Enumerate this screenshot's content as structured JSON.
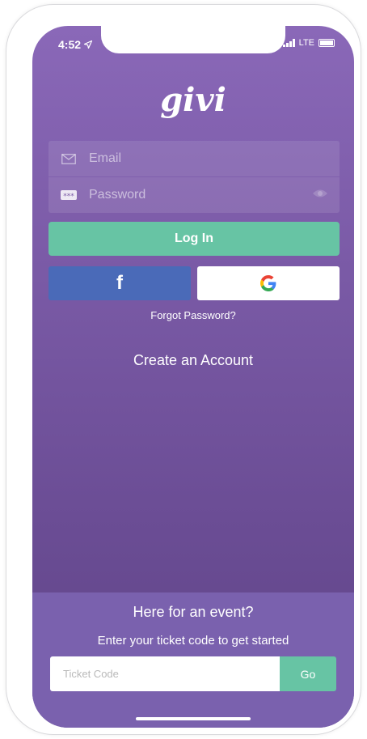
{
  "status_bar": {
    "time": "4:52",
    "network": "LTE"
  },
  "app": {
    "logo_text": "givi"
  },
  "login_form": {
    "email_placeholder": "Email",
    "password_placeholder": "Password",
    "login_label": "Log In",
    "facebook_label": "f",
    "forgot_label": "Forgot Password?",
    "create_account_label": "Create an Account"
  },
  "event_section": {
    "title": "Here for an event?",
    "subtitle": "Enter your ticket code to get started",
    "ticket_placeholder": "Ticket Code",
    "go_label": "Go"
  },
  "icons": {
    "email": "envelope-icon",
    "password": "password-dots-icon",
    "visibility": "eye-icon",
    "facebook": "facebook-icon",
    "google": "google-icon",
    "location": "location-arrow-icon"
  },
  "colors": {
    "primary_purple": "#7a5aa6",
    "accent_green": "#67c4a4",
    "facebook_blue": "#4a6ab8",
    "event_panel": "#7a61ae"
  }
}
